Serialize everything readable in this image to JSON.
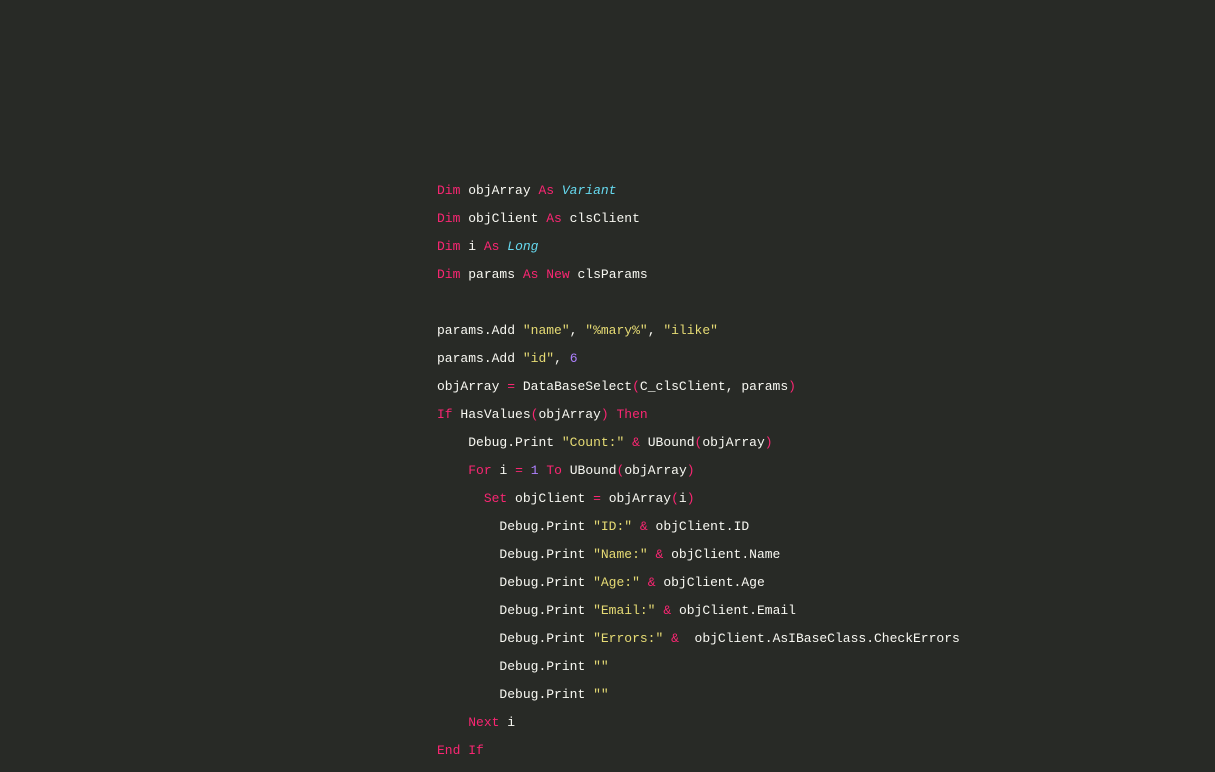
{
  "code": {
    "line1": {
      "kw_dim": "Dim",
      "id_objArray": "objArray",
      "kw_as": "As",
      "type_variant": "Variant"
    },
    "line2": {
      "kw_dim": "Dim",
      "id_objClient": "objClient",
      "kw_as": "As",
      "type_clsClient": "clsClient"
    },
    "line3": {
      "kw_dim": "Dim",
      "id_i": "i",
      "kw_as": "As",
      "type_long": "Long"
    },
    "line4": {
      "kw_dim": "Dim",
      "id_params": "params",
      "kw_as": "As",
      "kw_new": "New",
      "type_clsParams": "clsParams"
    },
    "line6": {
      "id_params": "params",
      "dot": ".",
      "method_add": "Add",
      "str_name": "\"name\"",
      "comma1": ",",
      "str_mary": "\"%mary%\"",
      "comma2": ",",
      "str_ilike": "\"ilike\""
    },
    "line7": {
      "id_params": "params",
      "dot": ".",
      "method_add": "Add",
      "str_id": "\"id\"",
      "comma": ",",
      "num_6": "6"
    },
    "line8": {
      "id_objArray": "objArray",
      "eq": "=",
      "fn_dbselect": "DataBaseSelect",
      "lparen": "(",
      "id_cclsclient": "C_clsClient",
      "comma": ",",
      "id_params": "params",
      "rparen": ")"
    },
    "line9": {
      "kw_if": "If",
      "fn_hasvalues": "HasValues",
      "lparen": "(",
      "id_objArray": "objArray",
      "rparen": ")",
      "kw_then": "Then"
    },
    "line10": {
      "id_debug": "Debug",
      "dot": ".",
      "method_print": "Print",
      "str_count": "\"Count:\"",
      "amp": "&",
      "fn_ubound": "UBound",
      "lparen": "(",
      "id_objArray": "objArray",
      "rparen": ")"
    },
    "line11": {
      "kw_for": "For",
      "id_i": "i",
      "eq": "=",
      "num_1": "1",
      "kw_to": "To",
      "fn_ubound": "UBound",
      "lparen": "(",
      "id_objArray": "objArray",
      "rparen": ")"
    },
    "line12": {
      "kw_set": "Set",
      "id_objClient": "objClient",
      "eq": "=",
      "id_objArray": "objArray",
      "lparen": "(",
      "id_i": "i",
      "rparen": ")"
    },
    "line13": {
      "id_debug": "Debug",
      "dot": ".",
      "method_print": "Print",
      "str_id": "\"ID:\"",
      "amp": "&",
      "id_objClient": "objClient",
      "dot2": ".",
      "prop_id": "ID"
    },
    "line14": {
      "id_debug": "Debug",
      "dot": ".",
      "method_print": "Print",
      "str_name": "\"Name:\"",
      "amp": "&",
      "id_objClient": "objClient",
      "dot2": ".",
      "prop_name": "Name"
    },
    "line15": {
      "id_debug": "Debug",
      "dot": ".",
      "method_print": "Print",
      "str_age": "\"Age:\"",
      "amp": "&",
      "id_objClient": "objClient",
      "dot2": ".",
      "prop_age": "Age"
    },
    "line16": {
      "id_debug": "Debug",
      "dot": ".",
      "method_print": "Print",
      "str_email": "\"Email:\"",
      "amp": "&",
      "id_objClient": "objClient",
      "dot2": ".",
      "prop_email": "Email"
    },
    "line17": {
      "id_debug": "Debug",
      "dot": ".",
      "method_print": "Print",
      "str_errors": "\"Errors:\"",
      "amp": "&",
      "id_objClient": "objClient",
      "dot2": ".",
      "prop_asibase": "AsIBaseClass",
      "dot3": ".",
      "method_checkerrors": "CheckErrors"
    },
    "line18": {
      "id_debug": "Debug",
      "dot": ".",
      "method_print": "Print",
      "str_empty": "\"\""
    },
    "line19": {
      "id_debug": "Debug",
      "dot": ".",
      "method_print": "Print",
      "str_empty": "\"\""
    },
    "line20": {
      "kw_next": "Next",
      "id_i": "i"
    },
    "line21": {
      "kw_endif": "End If"
    }
  }
}
